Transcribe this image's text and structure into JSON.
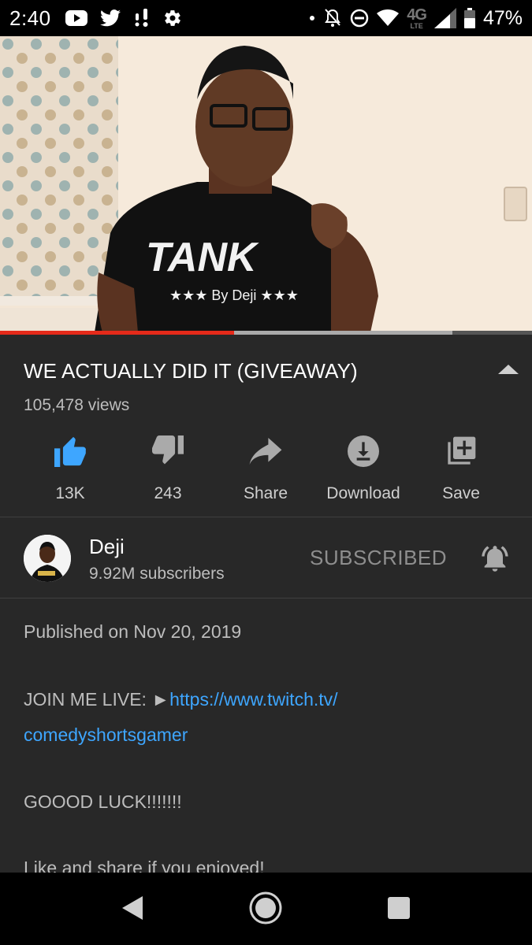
{
  "status_bar": {
    "time": "2:40",
    "network_label": "4G",
    "lte_label": "LTE",
    "battery_percent": "47%",
    "icons": [
      "youtube-icon",
      "twitter-icon",
      "notification-dots-icon",
      "gear-icon",
      "dot-icon",
      "bell-off-icon",
      "do-not-disturb-icon",
      "wifi-icon",
      "signal-icon",
      "battery-icon"
    ]
  },
  "player": {
    "progress_played": 0.44,
    "progress_buffered": 0.85
  },
  "video": {
    "title": "WE ACTUALLY DID IT (GIVEAWAY)",
    "views": "105,478 views"
  },
  "actions": [
    {
      "label": "13K",
      "icon": "thumbs-up-icon",
      "active": true
    },
    {
      "label": "243",
      "icon": "thumbs-down-icon",
      "active": false
    },
    {
      "label": "Share",
      "icon": "share-icon",
      "active": false
    },
    {
      "label": "Download",
      "icon": "download-icon",
      "active": false
    },
    {
      "label": "Save",
      "icon": "add-to-playlist-icon",
      "active": false
    }
  ],
  "channel": {
    "name": "Deji",
    "subscribers": "9.92M subscribers",
    "subscribe_label": "SUBSCRIBED"
  },
  "description": {
    "published": "Published on Nov 20, 2019",
    "join_prefix": "JOIN ME LIVE: ►",
    "link_part1": "https://www.twitch.tv/",
    "link_part2": "comedyshortsgamer",
    "good_luck": "GOOOD LUCK!!!!!!!",
    "like_share": "Like and share if you enjoyed!"
  },
  "colors": {
    "accent_blue": "#3ea6ff",
    "progress_red": "#e52a1a",
    "panel_bg": "#282828"
  }
}
